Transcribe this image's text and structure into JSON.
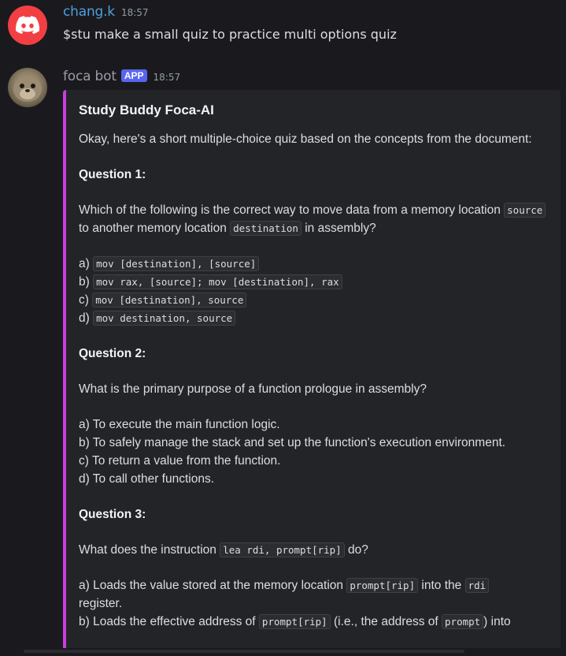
{
  "messages": [
    {
      "username": "chang.k",
      "timestamp": "18:57",
      "text": "$stu make a small quiz to practice multi options quiz",
      "avatar_icon": "discord-logo-icon"
    },
    {
      "username": "foca bot",
      "badge": "APP",
      "timestamp": "18:57",
      "avatar_icon": "seal-avatar"
    }
  ],
  "embed": {
    "title": "Study Buddy Foca-AI",
    "intro": "Okay, here's a short multiple-choice quiz based on the concepts from the document:",
    "q1": {
      "heading": "Question 1:",
      "text_a": "Which of the following is the correct way to move data from a memory location ",
      "code_a": "source",
      "text_b": " to another memory location ",
      "code_b": "destination",
      "text_c": " in assembly?",
      "options": [
        {
          "prefix": "a) ",
          "code": "mov [destination], [source]"
        },
        {
          "prefix": "b) ",
          "code": "mov rax, [source]; mov [destination], rax"
        },
        {
          "prefix": "c) ",
          "code": "mov [destination], source"
        },
        {
          "prefix": "d) ",
          "code": "mov destination, source"
        }
      ]
    },
    "q2": {
      "heading": "Question 2:",
      "text": "What is the primary purpose of a function prologue in assembly?",
      "options": [
        "a) To execute the main function logic.",
        "b) To safely manage the stack and set up the function's execution environment.",
        "c) To return a value from the function.",
        "d) To call other functions."
      ]
    },
    "q3": {
      "heading": "Question 3:",
      "text_a": "What does the instruction ",
      "code": "lea rdi, prompt[rip]",
      "text_b": " do?",
      "opt_a_1": "a) Loads the value stored at the memory location ",
      "opt_a_code1": "prompt[rip]",
      "opt_a_2": " into the ",
      "opt_a_code2": "rdi",
      "opt_a_3": "register.",
      "opt_b_1": "b) Loads the effective address of ",
      "opt_b_code1": "prompt[rip]",
      "opt_b_2": " (i.e., the address of ",
      "opt_b_code2": "prompt",
      "opt_b_3": ") into"
    }
  },
  "colors": {
    "background": "#1a1a1e",
    "embed_bg": "#232428",
    "embed_accent": "#c93ee0",
    "username_chang": "#4f9fde",
    "app_badge": "#5865f2"
  }
}
